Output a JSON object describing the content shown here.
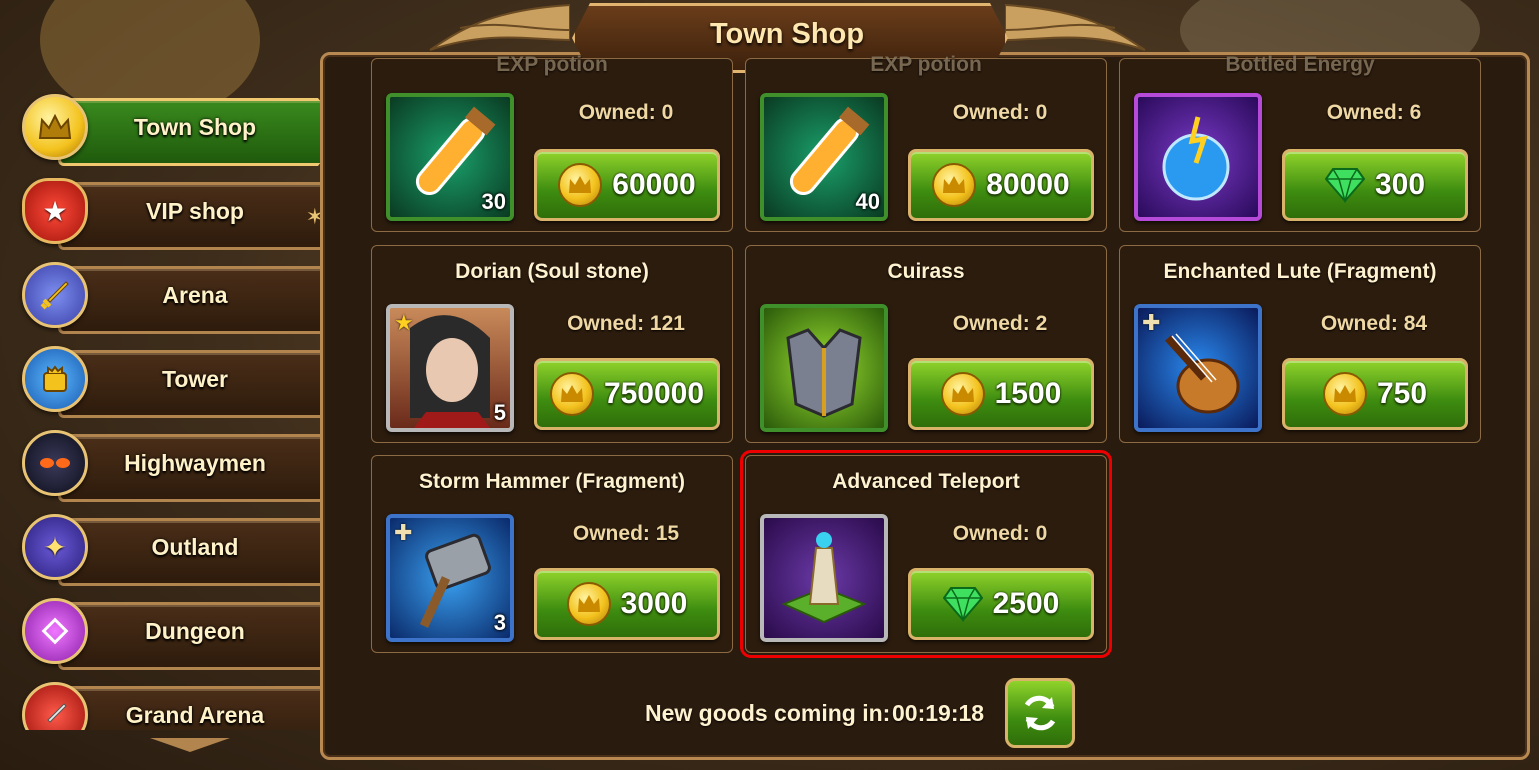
{
  "title": "Town Shop",
  "sidebar": {
    "items": [
      {
        "label": "Town Shop",
        "icon": "crown-coin-icon",
        "active": true
      },
      {
        "label": "VIP shop",
        "icon": "vip-shield-icon",
        "active": false
      },
      {
        "label": "Arena",
        "icon": "sword-icon",
        "active": false
      },
      {
        "label": "Tower",
        "icon": "tower-crown-icon",
        "active": false
      },
      {
        "label": "Highwaymen",
        "icon": "masked-face-icon",
        "active": false
      },
      {
        "label": "Outland",
        "icon": "sparkle-star-icon",
        "active": false
      },
      {
        "label": "Dungeon",
        "icon": "dungeon-portal-icon",
        "active": false
      },
      {
        "label": "Grand Arena",
        "icon": "shield-sword-icon",
        "active": false
      }
    ]
  },
  "shop": {
    "items": [
      {
        "name": "EXP potion",
        "owned": "Owned: 0",
        "price": "60000",
        "currency": "coin",
        "qty": "30",
        "icon": "exp-potion-icon"
      },
      {
        "name": "EXP potion",
        "owned": "Owned: 0",
        "price": "80000",
        "currency": "coin",
        "qty": "40",
        "icon": "exp-potion-icon"
      },
      {
        "name": "Bottled Energy",
        "owned": "Owned: 6",
        "price": "300",
        "currency": "gem",
        "qty": "",
        "icon": "energy-orb-icon"
      },
      {
        "name": "Dorian (Soul stone)",
        "owned": "Owned: 121",
        "price": "750000",
        "currency": "coin",
        "qty": "5",
        "icon": "dorian-portrait-icon"
      },
      {
        "name": "Cuirass",
        "owned": "Owned: 2",
        "price": "1500",
        "currency": "coin",
        "qty": "",
        "icon": "cuirass-armor-icon"
      },
      {
        "name": "Enchanted Lute (Fragment)",
        "owned": "Owned: 84",
        "price": "750",
        "currency": "coin",
        "qty": "",
        "icon": "lute-icon"
      },
      {
        "name": "Storm Hammer (Fragment)",
        "owned": "Owned: 15",
        "price": "3000",
        "currency": "coin",
        "qty": "3",
        "icon": "storm-hammer-icon"
      },
      {
        "name": "Advanced Teleport",
        "owned": "Owned: 0",
        "price": "2500",
        "currency": "gem",
        "qty": "",
        "icon": "teleport-tower-icon"
      }
    ]
  },
  "footer": {
    "refresh_label": "New goods coming in:",
    "timer": "00:19:18"
  }
}
